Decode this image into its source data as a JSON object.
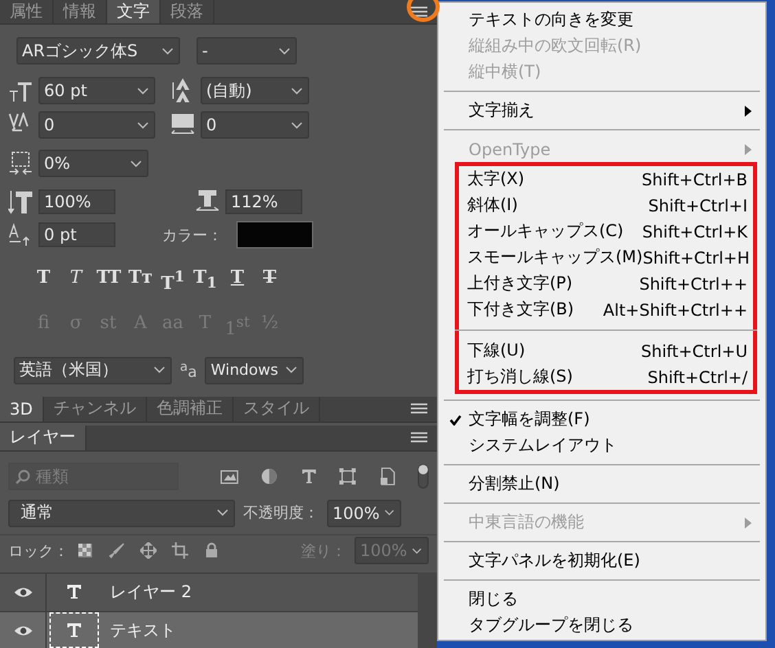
{
  "character_panel": {
    "tabs": [
      {
        "label": "属性",
        "selected": false
      },
      {
        "label": "情報",
        "selected": false
      },
      {
        "label": "文字",
        "selected": true
      },
      {
        "label": "段落",
        "selected": false
      }
    ],
    "menu_button_circled": true,
    "font_family": "ARゴシック体S",
    "font_style": "-",
    "size": "60 pt",
    "leading": "(自動)",
    "kerning": "0",
    "tracking": "0",
    "tsume": "0%",
    "vertical_scale": "100%",
    "horizontal_scale": "112%",
    "baseline_shift": "0 pt",
    "color_label": "カラー：",
    "style_buttons": [
      {
        "glyph": "T",
        "kind": "bold"
      },
      {
        "glyph": "T",
        "kind": "italic"
      },
      {
        "glyph": "TT",
        "kind": "caps"
      },
      {
        "glyph": "Tᴛ",
        "kind": "smallcaps"
      },
      {
        "glyph": "T$^{1}$",
        "kind": "plain"
      },
      {
        "glyph": "T$_{1}$",
        "kind": "plain"
      },
      {
        "glyph": "T",
        "kind": "underline"
      },
      {
        "glyph": "T",
        "kind": "strike"
      }
    ],
    "opentype_buttons": [
      {
        "glyph": "fi",
        "disabled": true
      },
      {
        "glyph": "σ",
        "disabled": true
      },
      {
        "glyph": "st",
        "disabled": true
      },
      {
        "glyph": "A",
        "disabled": true
      },
      {
        "glyph": "aa",
        "disabled": true
      },
      {
        "glyph": "T",
        "disabled": true
      },
      {
        "glyph": "1$^{st}$",
        "disabled": true
      },
      {
        "glyph": "½",
        "disabled": true
      }
    ],
    "language": "英語（米国）",
    "antialias_glyph": "$^{a}$a",
    "antialias": "Windows"
  },
  "lower_tabs": [
    {
      "label": "3D",
      "selected": true
    },
    {
      "label": "チャンネル",
      "selected": false
    },
    {
      "label": "色調補正",
      "selected": false
    },
    {
      "label": "スタイル",
      "selected": false
    }
  ],
  "layers_panel": {
    "tabs": [
      {
        "label": "レイヤー",
        "selected": true
      }
    ],
    "filter_placeholder": "種類",
    "blend_mode": "通常",
    "opacity_label": "不透明度：",
    "opacity": "100%",
    "lock_label": "ロック：",
    "fill_label": "塗り：",
    "fill": "100%",
    "fill_disabled": true,
    "layers": [
      {
        "name": "レイヤー 2",
        "visible": true,
        "selected": false
      },
      {
        "name": "テキスト",
        "visible": true,
        "selected": true
      }
    ]
  },
  "menu": {
    "groups": [
      {
        "framed": false,
        "entries": [
          {
            "kind": "item",
            "label": "テキストの向きを変更",
            "disabled": false,
            "checked": false
          },
          {
            "kind": "item",
            "label": "縦組み中の欧文回転(R)",
            "disabled": true,
            "checked": false
          },
          {
            "kind": "item",
            "label": "縦中横(T)",
            "disabled": true,
            "checked": false
          },
          {
            "kind": "separator"
          },
          {
            "kind": "submenu",
            "label": "文字揃え",
            "disabled": false,
            "checked": false
          },
          {
            "kind": "separator"
          },
          {
            "kind": "submenu",
            "label": "OpenType",
            "disabled": true,
            "checked": false
          }
        ]
      },
      {
        "framed": true,
        "entries": [
          {
            "kind": "item",
            "label": "太字(X)",
            "shortcut": "Shift+Ctrl+B",
            "disabled": false,
            "checked": false
          },
          {
            "kind": "item",
            "label": "斜体(I)",
            "shortcut": "Shift+Ctrl+I",
            "disabled": false,
            "checked": false
          },
          {
            "kind": "item",
            "label": "オールキャップス(C)",
            "shortcut": "Shift+Ctrl+K",
            "disabled": false,
            "checked": false
          },
          {
            "kind": "item",
            "label": "スモールキャップス(M)",
            "shortcut": "Shift+Ctrl+H",
            "disabled": false,
            "checked": false
          },
          {
            "kind": "item",
            "label": "上付き文字(P)",
            "shortcut": "Shift+Ctrl++",
            "disabled": false,
            "checked": false
          },
          {
            "kind": "item",
            "label": "下付き文字(B)",
            "shortcut": "Alt+Shift+Ctrl++",
            "disabled": false,
            "checked": false
          },
          {
            "kind": "separator"
          },
          {
            "kind": "item",
            "label": "下線(U)",
            "shortcut": "Shift+Ctrl+U",
            "disabled": false,
            "checked": false
          },
          {
            "kind": "item",
            "label": "打ち消し線(S)",
            "shortcut": "Shift+Ctrl+/",
            "disabled": false,
            "checked": false
          }
        ]
      },
      {
        "framed": false,
        "entries": [
          {
            "kind": "separator"
          },
          {
            "kind": "item",
            "label": "文字幅を調整(F)",
            "disabled": false,
            "checked": true
          },
          {
            "kind": "item",
            "label": "システムレイアウト",
            "disabled": false,
            "checked": false
          },
          {
            "kind": "separator"
          },
          {
            "kind": "item",
            "label": "分割禁止(N)",
            "disabled": false,
            "checked": false
          },
          {
            "kind": "separator"
          },
          {
            "kind": "submenu",
            "label": "中東言語の機能",
            "disabled": true,
            "checked": false
          },
          {
            "kind": "separator"
          },
          {
            "kind": "item",
            "label": "文字パネルを初期化(E)",
            "disabled": false,
            "checked": false
          },
          {
            "kind": "separator"
          },
          {
            "kind": "item",
            "label": "閉じる",
            "disabled": false,
            "checked": false
          },
          {
            "kind": "item",
            "label": "タブグループを閉じる",
            "disabled": false,
            "checked": false
          }
        ]
      }
    ]
  }
}
